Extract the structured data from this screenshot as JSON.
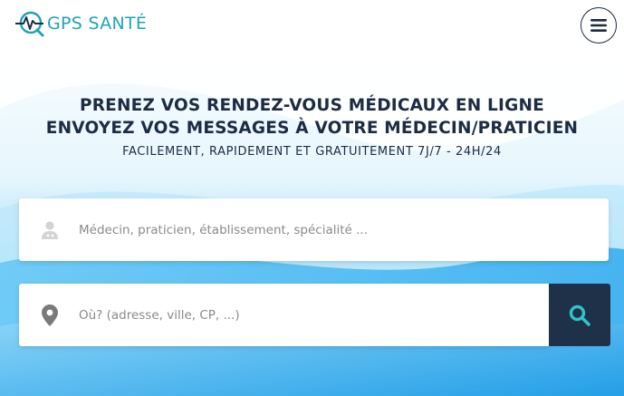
{
  "brand": {
    "name": "GPS SANTÉ",
    "color": "#1fa3b6"
  },
  "hero": {
    "title_line1": "PRENEZ VOS RENDEZ-VOUS MÉDICAUX EN LIGNE",
    "title_line2": "ENVOYEZ VOS MESSAGES À VOTRE MÉDECIN/PRATICIEN",
    "subtitle": "FACILEMENT, RAPIDEMENT ET GRATUITEMENT 7J/7 - 24H/24"
  },
  "search": {
    "who_placeholder": "Médecin, praticien, établissement, spécialité ...",
    "who_value": "",
    "who_icon": "doctor-icon",
    "where_placeholder": "Où? (adresse, ville, CP, ...)",
    "where_value": "",
    "where_icon": "map-pin-icon",
    "button_icon": "search-icon"
  },
  "colors": {
    "navy": "#1c2c44",
    "button": "#1e3148",
    "accent": "#2ec4c9"
  }
}
